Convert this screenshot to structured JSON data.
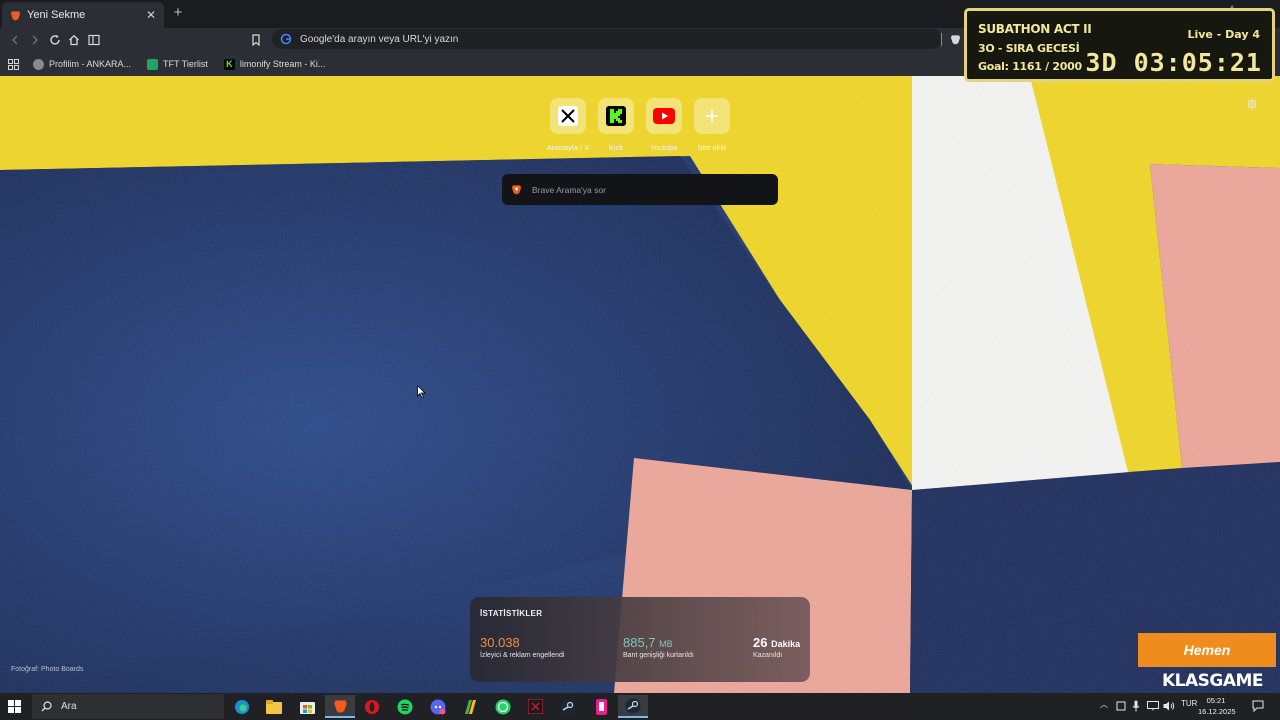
{
  "browser": {
    "tab_title": "Yeni Sekme",
    "omnibox_placeholder": "Google'da arayın veya URL'yi yazın",
    "bookmarks": [
      {
        "label": "Profilim - ANKARA..."
      },
      {
        "label": "TFT Tierlist"
      },
      {
        "label": "limonify Stream - Ki..."
      }
    ]
  },
  "top_sites": [
    {
      "label": "Anasayfa / X",
      "icon": "x-logo-icon"
    },
    {
      "label": "Kick",
      "icon": "kick-logo-icon"
    },
    {
      "label": "Youtube",
      "icon": "youtube-logo-icon"
    },
    {
      "label": "Site ekle",
      "icon": "plus-icon"
    }
  ],
  "search": {
    "placeholder": "Brave Arama'ya sor"
  },
  "stats": {
    "heading": "İSTATİSTİKLER",
    "blocked_value": "30.038",
    "blocked_caption": "İzleyici & reklam engellendi",
    "bandwidth_value": "885,7",
    "bandwidth_unit": "MB",
    "bandwidth_caption": "Bant genişliği kurtarıldı",
    "time_value": "26",
    "time_unit": "Dakika",
    "time_caption": "Kazanıldı"
  },
  "photo_credit": "Fotoğraf: Photo Boards",
  "overlay": {
    "title": "SUBATHON ACT II",
    "subtitle": "3O - SIRA GECESİ",
    "goal": "Goal: 1161 / 2000",
    "live": "Live - Day 4",
    "timer": "3D 03:05:21"
  },
  "ad": {
    "button": "Hemen",
    "brand": "KLASGAME"
  },
  "taskbar": {
    "search_placeholder": "Ara",
    "language": "TUR",
    "time": "05:21",
    "date": "16.12.2025"
  },
  "colors": {
    "wall_blue": "#1e2f5c",
    "wall_yellow": "#f0d628",
    "wall_pink": "#eda69a",
    "brave_orange": "#f25a1f",
    "stat_orange": "#f08a4b",
    "stat_teal": "#7ec6bf",
    "overlay_gold": "#f4e79c"
  }
}
